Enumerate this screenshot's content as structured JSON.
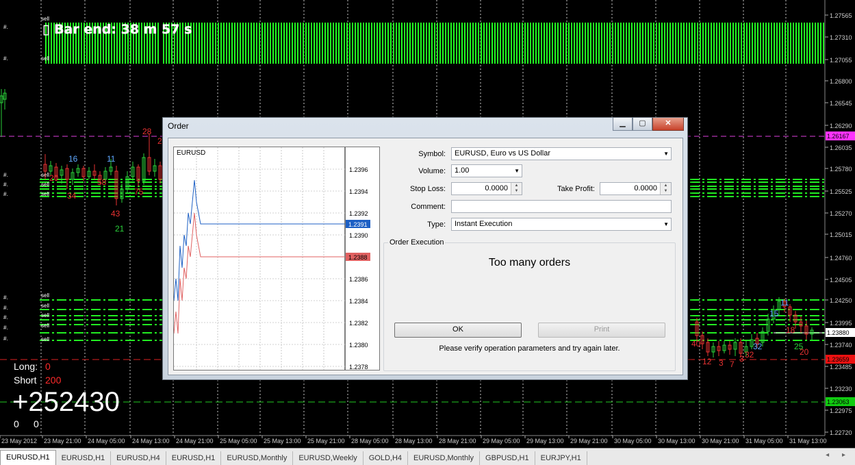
{
  "chart": {
    "timer_text": "Bar end: 38 m 57 s",
    "price_labels": [
      "1.27565",
      "1.27310",
      "1.27055",
      "1.26800",
      "1.26545",
      "1.26290",
      "1.26167",
      "1.26035",
      "1.25780",
      "1.25525",
      "1.25270",
      "1.25015",
      "1.24760",
      "1.24505",
      "1.24250",
      "1.23995",
      "1.23880",
      "1.23740",
      "1.23659",
      "1.23485",
      "1.23230",
      "1.23063",
      "1.22975",
      "1.22720"
    ],
    "marker_price_pink": "1.26167",
    "marker_price_current": "1.23880",
    "marker_price_red": "1.23659",
    "marker_price_green": "1.23063",
    "time_labels": [
      "23 May 2012",
      "23 May 21:00",
      "24 May 05:00",
      "24 May 13:00",
      "24 May 21:00",
      "25 May 05:00",
      "25 May 13:00",
      "25 May 21:00",
      "28 May 05:00",
      "28 May 13:00",
      "28 May 21:00",
      "29 May 05:00",
      "29 May 13:00",
      "29 May 21:00",
      "30 May 05:00",
      "30 May 13:00",
      "30 May 21:00",
      "31 May 05:00",
      "31 May 13:00"
    ],
    "sell_label": "sell",
    "hash_label": "#.",
    "left_numbers": [
      "20",
      "34",
      "58",
      "43",
      "21",
      "28",
      "20",
      "75",
      "16",
      "11"
    ],
    "right_numbers": [
      "40",
      "12",
      "3",
      "7",
      "32",
      "3",
      "32",
      "25",
      "20",
      "11",
      "15",
      "18"
    ],
    "long_label": "Long:",
    "long_value": "0",
    "short_label": "Short",
    "short_value": "200",
    "profit_value": "+252430",
    "zero_a": "0",
    "zero_b": "0"
  },
  "tabs": [
    "EURUSD,H1",
    "EURUSD,H1",
    "EURUSD,H4",
    "EURUSD,H1",
    "EURUSD,Monthly",
    "EURUSD,Weekly",
    "GOLD,H4",
    "EURUSD,Monthly",
    "GBPUSD,H1",
    "EURJPY,H1"
  ],
  "tab_nav": "◂ ▸",
  "dialog": {
    "title": "Order",
    "min_icon": "▁",
    "max_icon": "▢",
    "close_icon": "✕",
    "mini_chart": {
      "symbol": "EURUSD",
      "price_ticks": [
        "1.2396",
        "1.2394",
        "1.2392",
        "1.2390",
        "1.2386",
        "1.2384",
        "1.2382",
        "1.2380",
        "1.2378"
      ],
      "ask_tag": "1.2391",
      "bid_tag": "1.2388",
      "ask_color": "#1c5fc4",
      "bid_color": "#e06060"
    },
    "symbol_label": "Symbol:",
    "symbol_value": "EURUSD, Euro vs US Dollar",
    "volume_label": "Volume:",
    "volume_value": "1.00",
    "stoploss_label": "Stop Loss:",
    "stoploss_value": "0.0000",
    "takeprofit_label": "Take Profit:",
    "takeprofit_value": "0.0000",
    "comment_label": "Comment:",
    "comment_value": "",
    "type_label": "Type:",
    "type_value": "Instant Execution",
    "group_title": "Order Execution",
    "message": "Too many orders",
    "ok_label": "OK",
    "print_label": "Print",
    "note": "Please verify operation parameters and try again later."
  }
}
